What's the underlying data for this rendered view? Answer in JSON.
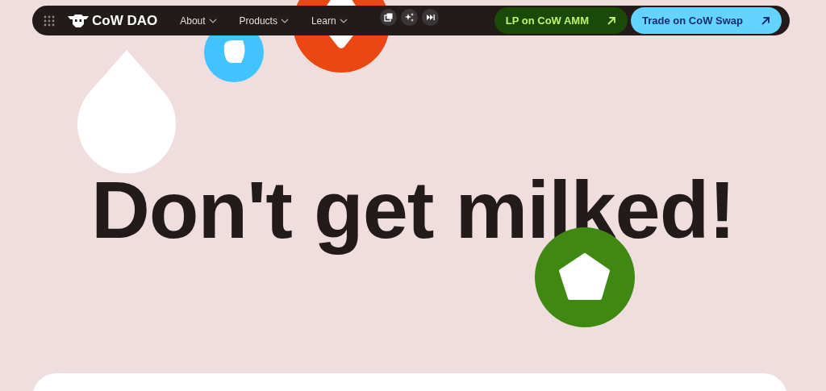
{
  "navbar": {
    "brand": "CoW DAO",
    "menu": [
      {
        "label": "About",
        "expanded": false
      },
      {
        "label": "Products",
        "expanded": false
      },
      {
        "label": "Learn",
        "expanded": false
      }
    ],
    "tools": [
      {
        "kind": "copy"
      },
      {
        "kind": "sparkle"
      },
      {
        "kind": "skip"
      }
    ],
    "buttons": [
      {
        "label": "LP on CoW AMM",
        "kind": "dark"
      },
      {
        "label": "Trade on CoW Swap",
        "kind": "light"
      }
    ]
  },
  "hero": {
    "heading": "Don't get milked!"
  }
}
